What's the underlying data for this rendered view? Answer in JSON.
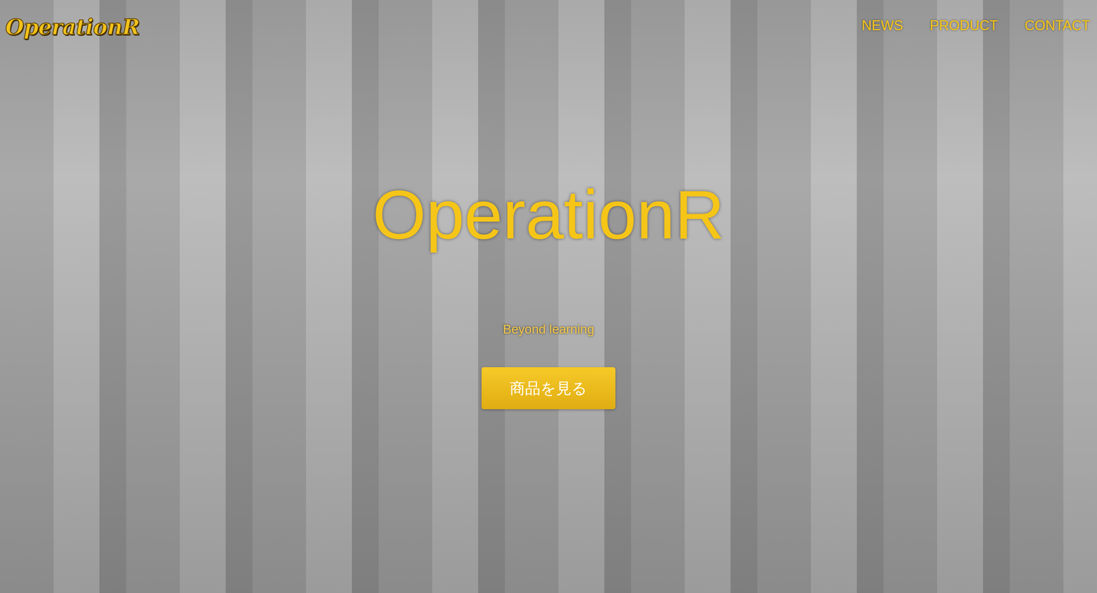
{
  "logo": {
    "text": "OperationR"
  },
  "nav": {
    "items": [
      {
        "label": "NEWS"
      },
      {
        "label": "PRODUCT"
      },
      {
        "label": "CONTACT"
      }
    ]
  },
  "hero": {
    "title": "OperationR",
    "tagline": "Beyond learning",
    "button": "商品を見る"
  }
}
